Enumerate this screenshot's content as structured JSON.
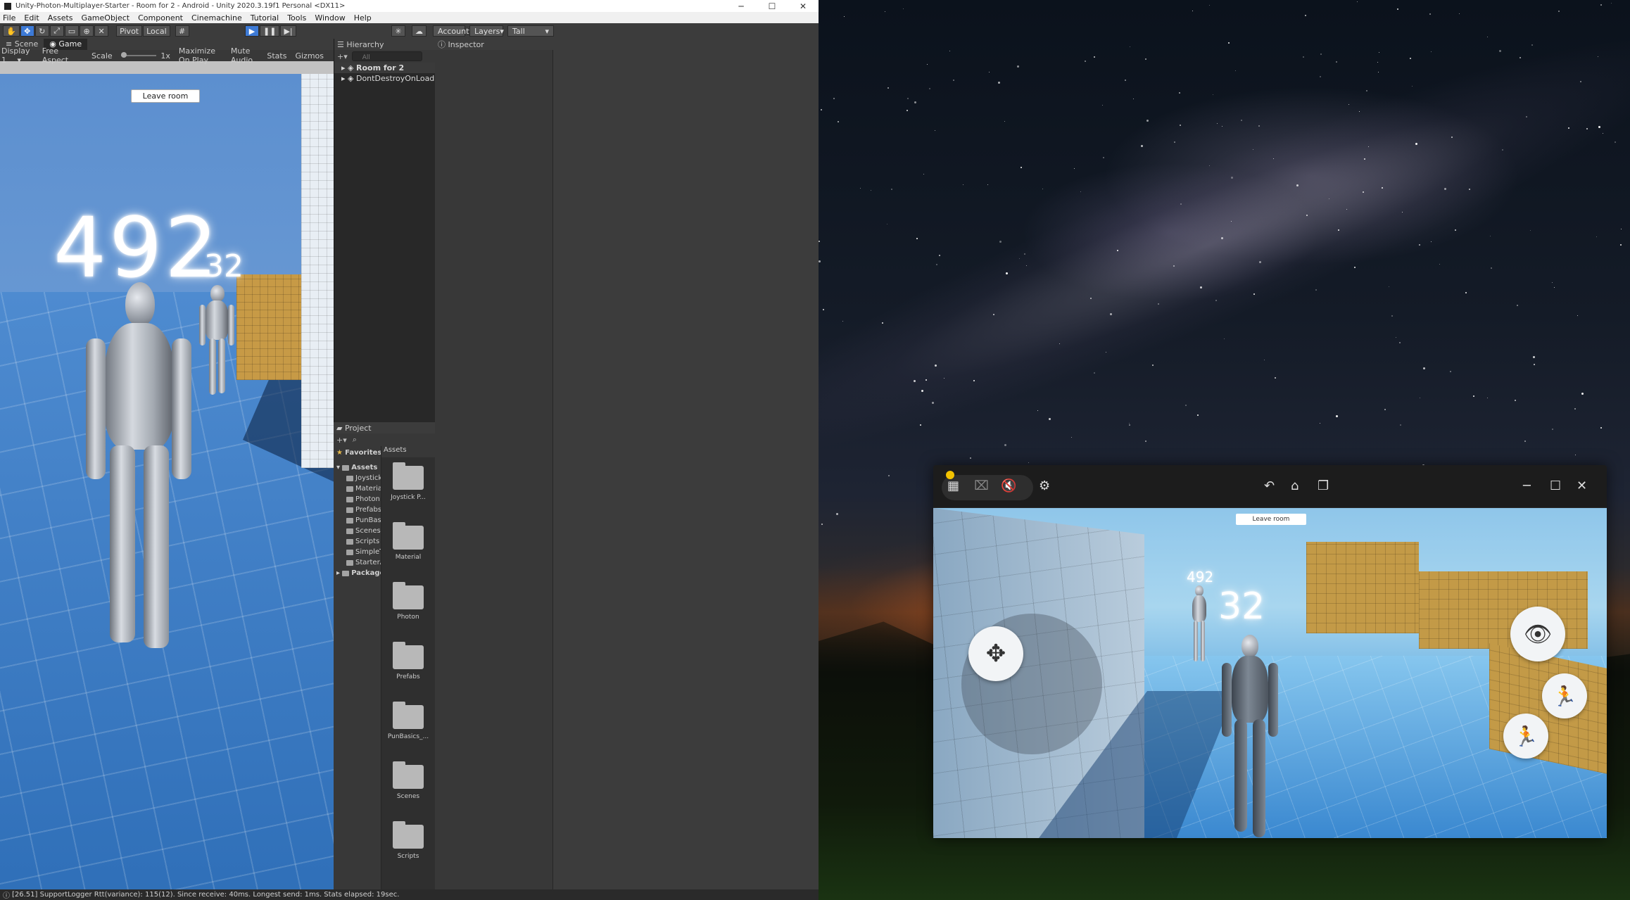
{
  "unity": {
    "title": "Unity-Photon-Multiplayer-Starter - Room for 2 - Android - Unity 2020.3.19f1 Personal <DX11>",
    "window_controls": [
      "─",
      "☐",
      "✕"
    ],
    "menu": [
      "File",
      "Edit",
      "Assets",
      "GameObject",
      "Component",
      "Cinemachine",
      "Tutorial",
      "Tools",
      "Window",
      "Help"
    ],
    "toolbar": {
      "pivot": "Pivot",
      "local": "Local",
      "account": "Account",
      "layers": "Layers",
      "layout": "Tall"
    },
    "tabs": {
      "scene": "Scene",
      "game": "Game"
    },
    "game_bar": {
      "display": "Display 1",
      "aspect": "Free Aspect",
      "scale_label": "Scale",
      "scale_value": "1x",
      "maximize": "Maximize On Play",
      "mute": "Mute Audio",
      "stats": "Stats",
      "gizmos": "Gizmos"
    },
    "game": {
      "leave_room": "Leave room",
      "big_number": "492",
      "small_number": "32"
    },
    "hierarchy": {
      "title": "Hierarchy",
      "search_placeholder": "All",
      "items": [
        "Room for 2",
        "DontDestroyOnLoad"
      ]
    },
    "inspector": {
      "title": "Inspector"
    },
    "project": {
      "title": "Project",
      "favorites": "Favorites",
      "assets_header": "Assets",
      "tree_root": "Assets",
      "tree": [
        "Joystick P...",
        "Material",
        "Photon",
        "Prefabs",
        "PunBasics_",
        "Scenes",
        "Scripts",
        "SimpleTou...",
        "StarterAss..."
      ],
      "packages": "Packages",
      "grid": [
        "Joystick P...",
        "Material",
        "Photon",
        "Prefabs",
        "PunBasics_...",
        "Scenes",
        "Scripts"
      ]
    },
    "status": "[26.51] SupportLogger Rtt(variance): 115(12). Since receive: 40ms. Longest send: 1ms. Stats elapsed: 19sec."
  },
  "mirror": {
    "leave_room": "Leave room",
    "big_number": "492",
    "small_number": "32"
  }
}
